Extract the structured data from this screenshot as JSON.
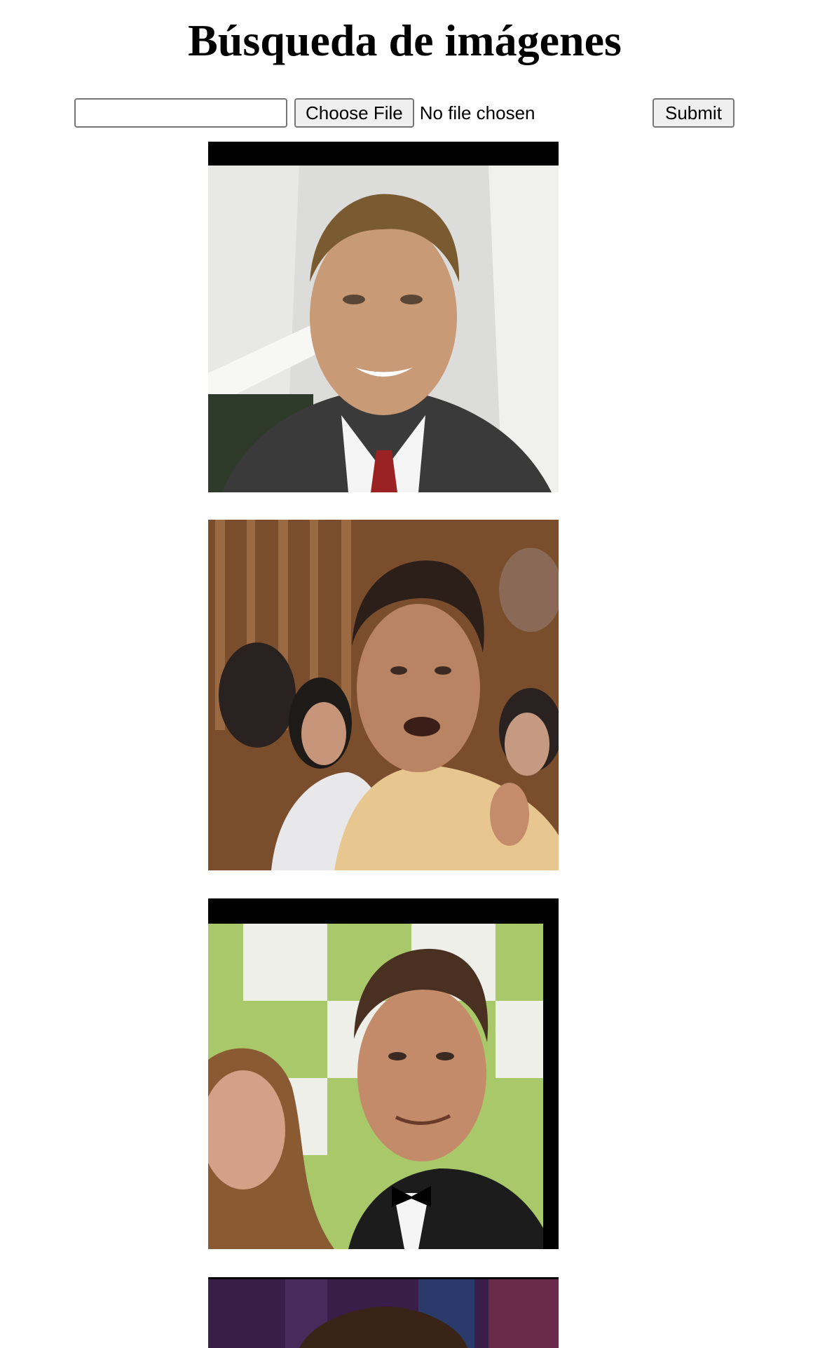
{
  "page": {
    "title": "Búsqueda de imágenes"
  },
  "form": {
    "text_input_value": "",
    "choose_file_label": "Choose File",
    "file_status": "No file chosen",
    "submit_label": "Submit"
  },
  "results": [
    {
      "subject": "portrait photo, smiling man in suit and red tie, light office background"
    },
    {
      "subject": "portrait photo, man in light patterned shirt pointing, crowd and brown curtain behind"
    },
    {
      "subject": "portrait photo, man in tuxedo with woman, green and white checkered backdrop"
    },
    {
      "subject": "portrait photo, partially visible, dark purple background"
    }
  ],
  "colors": {
    "background": "#ffffff",
    "button_bg": "#efefef",
    "border": "#767676"
  }
}
